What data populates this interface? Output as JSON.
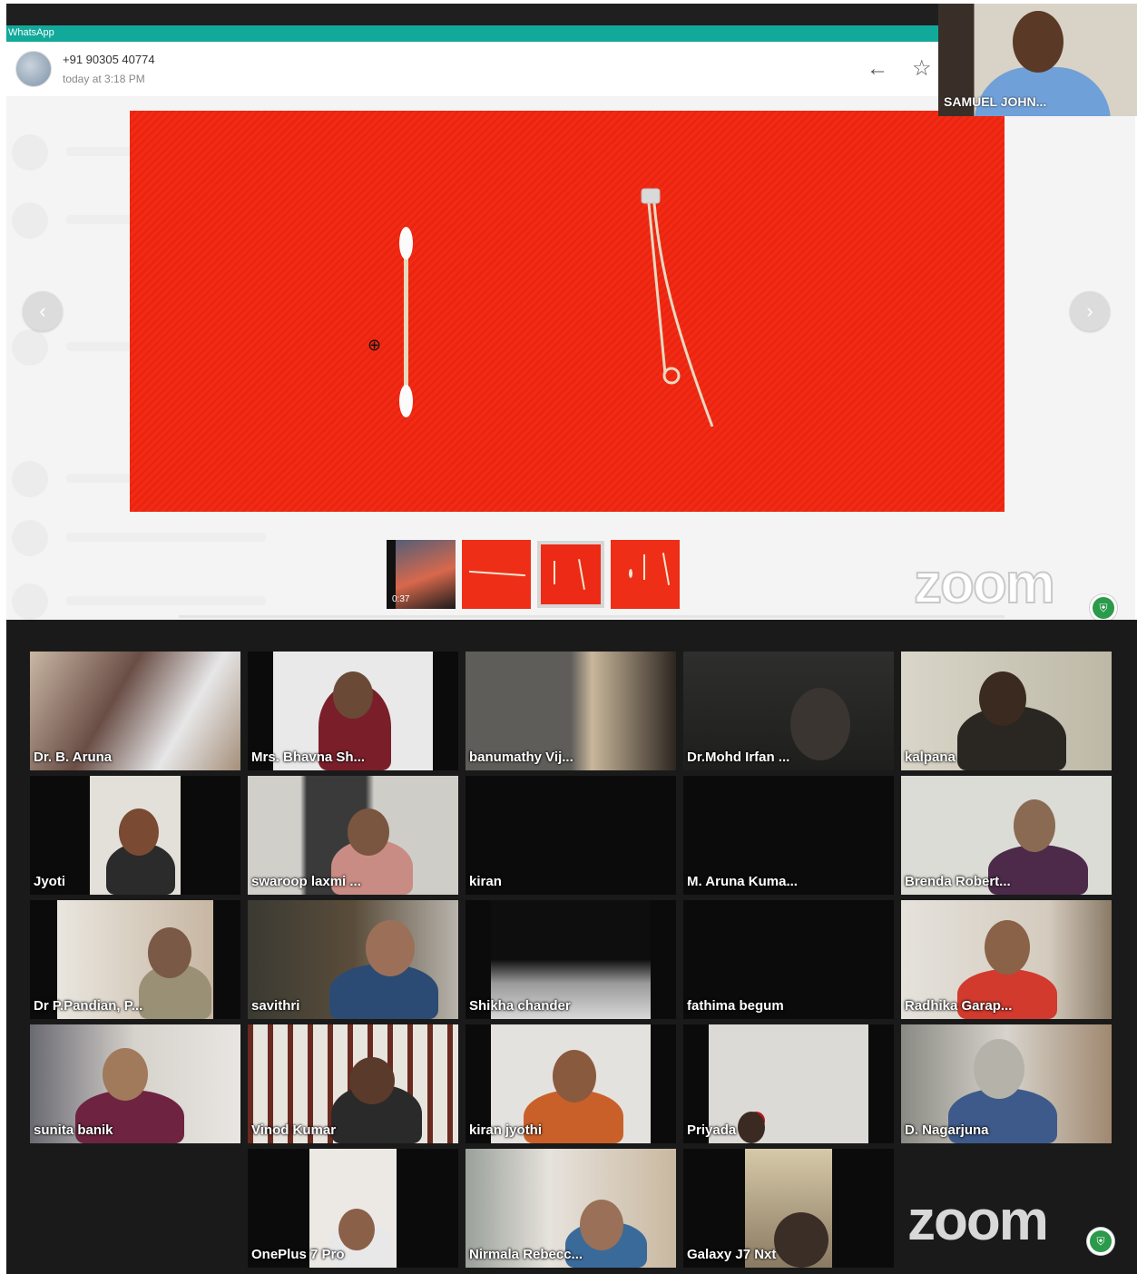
{
  "whatsapp": {
    "app_title": "WhatsApp",
    "contact_number": "+91 90305 40774",
    "timestamp": "today at 3:18 PM",
    "icons": {
      "back": "arrow-left-icon",
      "star": "star-icon",
      "prev": "chevron-left-icon",
      "next": "chevron-right-icon",
      "cursor": "zoom-in-cursor-icon"
    }
  },
  "media": {
    "thumbnails": [
      {
        "type": "video",
        "duration": "0:37"
      },
      {
        "type": "image"
      },
      {
        "type": "image",
        "selected": true
      },
      {
        "type": "image"
      }
    ]
  },
  "zoom": {
    "logo_text": "zoom"
  },
  "speaker": {
    "name": "SAMUEL JOHN..."
  },
  "participants": [
    "Dr. B. Aruna",
    "Mrs. Bhavna Sh...",
    "banumathy Vij...",
    "Dr.Mohd Irfan ...",
    "kalpana",
    "Jyoti",
    "swaroop laxmi ...",
    "kiran",
    "M. Aruna Kuma...",
    "Brenda Robert...",
    "Dr P.Pandian, P...",
    "savithri",
    "Shikha chander",
    "fathima begum",
    "Radhika Garap...",
    "sunita banik",
    "Vinod Kumar",
    "kiran jyothi",
    "Priyada",
    "D. Nagarjuna",
    "OnePlus 7 Pro",
    "Nirmala Rebecc...",
    "Galaxy J7 Nxt"
  ],
  "colors": {
    "whatsapp_teal": "#11a99a",
    "fabric_red": "#f22c14",
    "zoom_badge": "#2b9a4a"
  }
}
